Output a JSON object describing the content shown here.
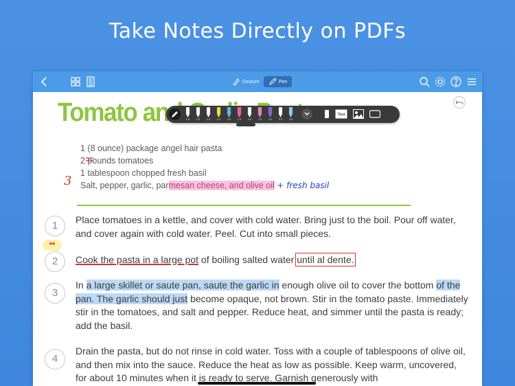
{
  "headline": "Take Notes Directly on PDFs",
  "toolbar": {
    "back_icon": "chevron-left-icon",
    "gesture_label": "Gesture",
    "pen_label": "Pen",
    "icons": [
      "grid-icon",
      "calculator-icon",
      "search-icon",
      "gear-icon",
      "help-icon",
      "menu-icon"
    ]
  },
  "pen_toolbar": {
    "pen_sizes": [
      "1.6",
      "2.3",
      "1.5",
      "2.0",
      "3.0",
      "1.5",
      "2.5",
      "1.5",
      "2.0",
      "2.3",
      "3.0"
    ],
    "pen_colors": [
      "#ffffff",
      "#ffffff",
      "#ffffff",
      "#f0e040",
      "#50b8f0",
      "#f060a0",
      "#ffffff",
      "#f080c0",
      "#8060e0",
      "#ffffff",
      "#80d0ff"
    ],
    "text_tool": "Text"
  },
  "recipe": {
    "title": "Tomato and Garlic Pasta",
    "ingredients": [
      "1 (8 ounce) package angel hair pasta",
      "2 pounds tomatoes",
      "1 tablespoon chopped fresh basil",
      "Salt, pepper, garlic, par"
    ],
    "ingredient_4_highlight": "mesan cheese, and olive oil",
    "annotation_fresh_basil": "+ fresh basil",
    "annotation_3": "3",
    "stars": "**"
  },
  "steps": [
    {
      "num": "1",
      "text": "Place tomatoes in a kettle, and cover with cold water. Bring just to the boil. Pour off water, and cover again with cold water. Peel. Cut into small pieces."
    },
    {
      "num": "2",
      "underlined": "Cook the pasta in a large pot",
      "middle": " of boiling salted water ",
      "boxed": "until al dente."
    },
    {
      "num": "3",
      "pre": "In ",
      "highlight1": "a large skillet or saute pan, saute the garlic in",
      "mid": " enough olive oil to cover the bottom ",
      "highlight2": "of the pan. The garlic should just",
      "post": " become opaque, not brown. Stir in the tomato paste. Immediately stir in the tomatoes, and salt and pepper. Reduce heat, and simmer until the pasta is ready; add the basil."
    },
    {
      "num": "4",
      "text": "Drain the pasta, but do not rinse in cold water. Toss with a couple of tablespoons of olive oil, and then mix into the sauce. Reduce the heat as low as possible. Keep warm, uncovered, for about 10 minutes when it is ready to serve. Garnish generously with"
    }
  ]
}
